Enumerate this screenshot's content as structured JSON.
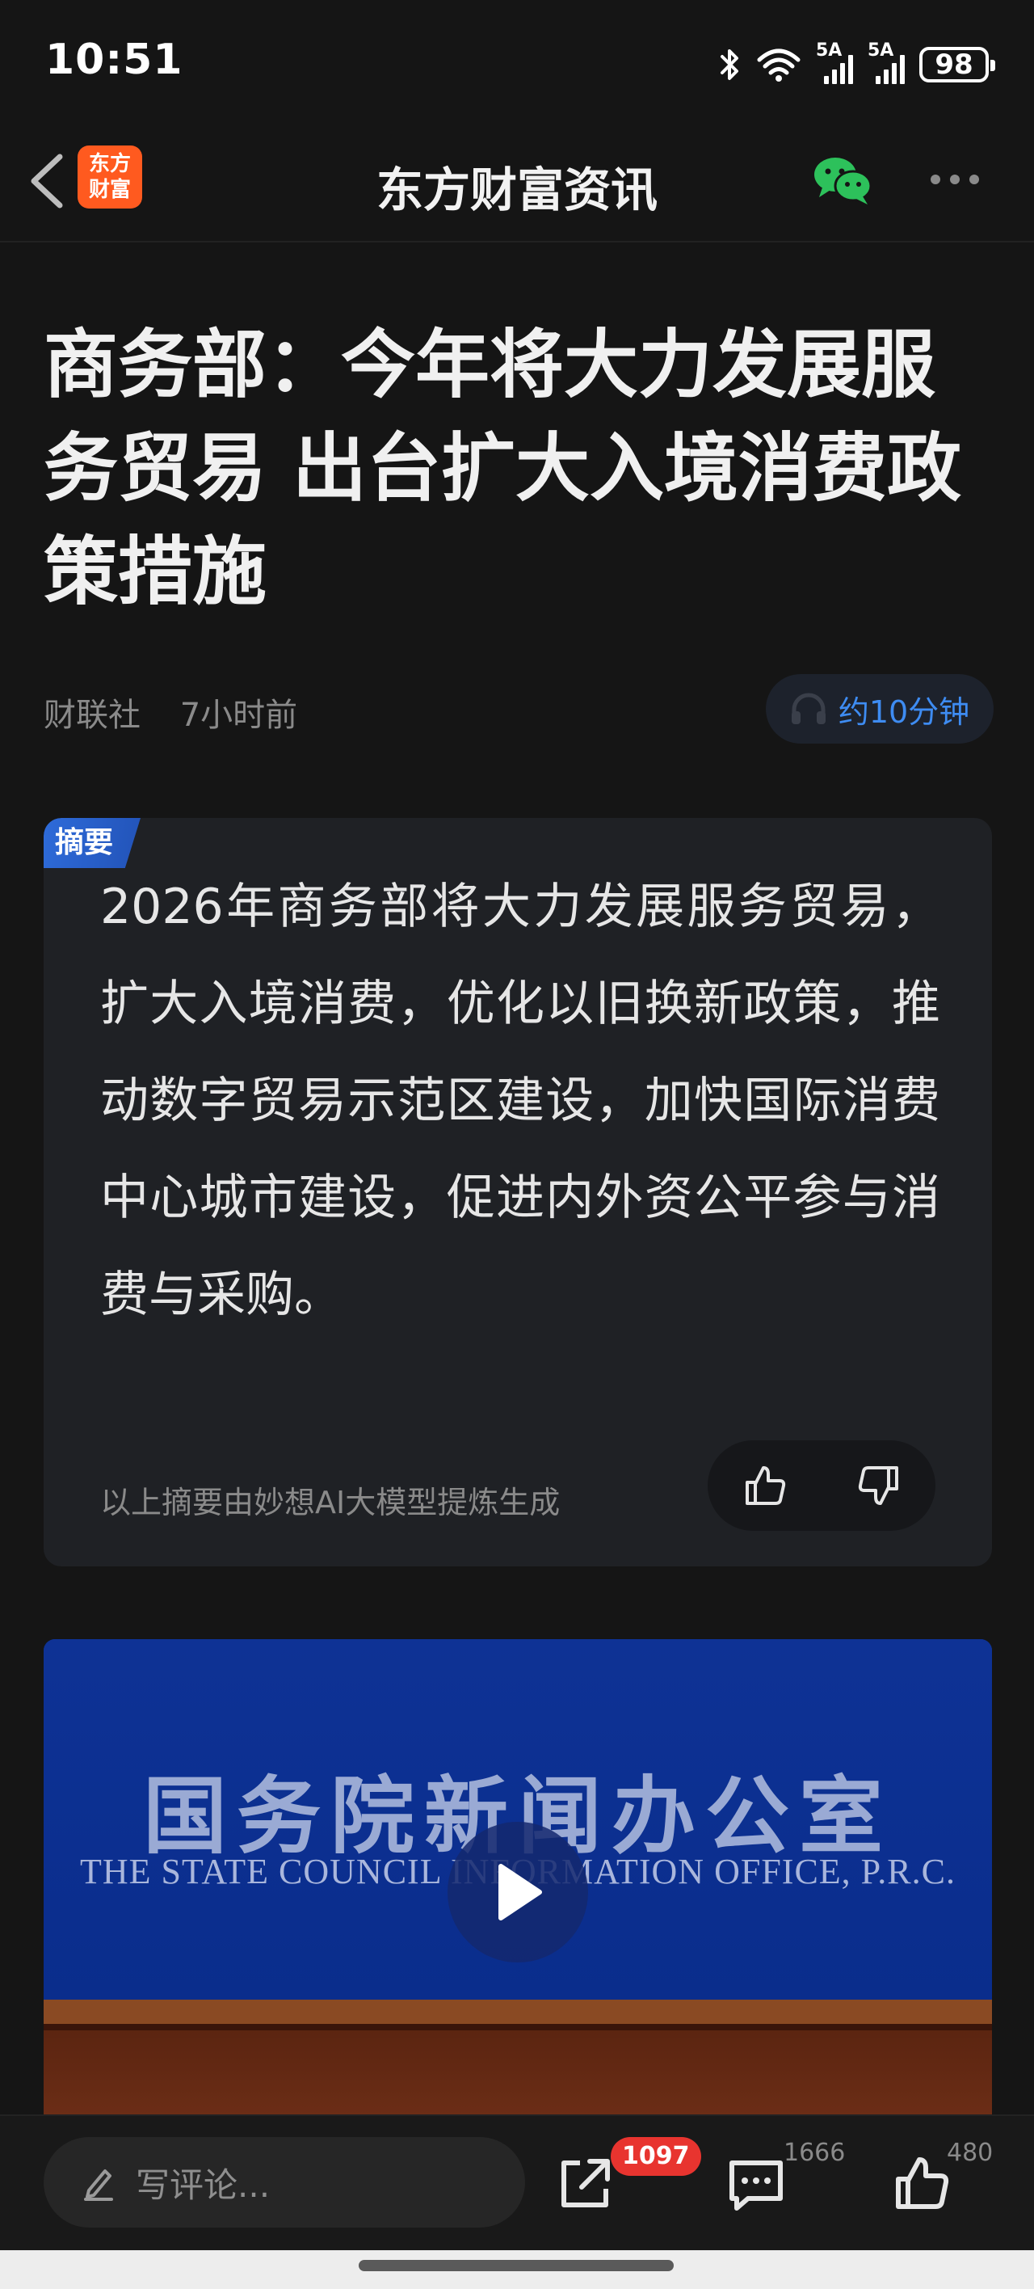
{
  "status_bar": {
    "time": "10:51",
    "network_1": "5A",
    "network_2": "5A",
    "battery": "98"
  },
  "nav": {
    "title": "东方财富资讯",
    "logo_line1": "东方",
    "logo_line2": "财富"
  },
  "article": {
    "title": "商务部：今年将大力发展服务贸易 出台扩大入境消费政策措施",
    "source": "财联社",
    "time": "7小时前",
    "listen_label": "约10分钟"
  },
  "summary": {
    "tag": "摘要",
    "text": "2026年商务部将大力发展服务贸易，扩大入境消费，优化以旧换新政策，推动数字贸易示范区建设，加快国际消费中心城市建设，促进内外资公平参与消费与采购。",
    "footnote": "以上摘要由妙想AI大模型提炼生成"
  },
  "video": {
    "sign_cn": "国务院新闻办公室",
    "sign_en": "THE STATE COUNCIL INFORMATION OFFICE, P.R.C."
  },
  "bottom_bar": {
    "comment_placeholder": "写评论...",
    "share_count": "1097",
    "comment_count": "1666",
    "like_count": "480"
  },
  "colors": {
    "background": "#151515",
    "accent_blue": "#3e8cf2",
    "logo_orange": "#ff5a1f",
    "badge_red": "#e8342f",
    "wechat_green": "#2dc15b"
  },
  "icons": {
    "back": "chevron-left-icon",
    "share_wechat": "wechat-icon",
    "more": "more-dots-icon",
    "listen": "headphones-icon",
    "like": "thumbs-up-icon",
    "dislike": "thumbs-down-icon",
    "play": "play-icon",
    "edit": "pencil-icon",
    "share": "share-icon",
    "comment": "comment-icon"
  }
}
